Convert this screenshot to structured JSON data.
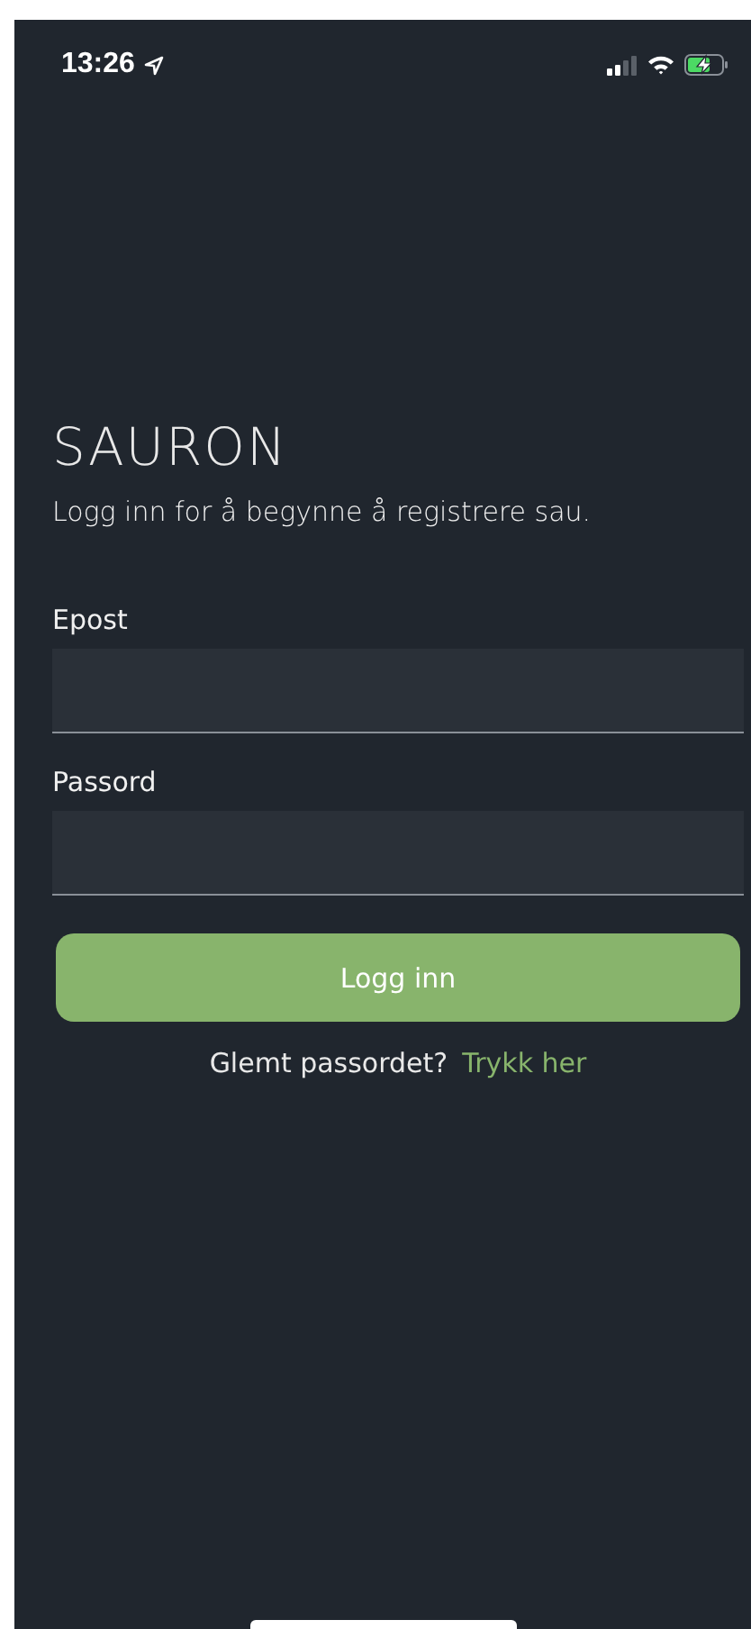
{
  "status_bar": {
    "time": "13:26"
  },
  "title": "SAURON",
  "subtitle": "Logg inn for å begynne å registrere sau.",
  "fields": [
    {
      "label": "Epost"
    },
    {
      "label": "Passord"
    }
  ],
  "login_button": "Logg inn",
  "forgot": {
    "text": "Glemt passordet?",
    "link": "Trykk her"
  }
}
